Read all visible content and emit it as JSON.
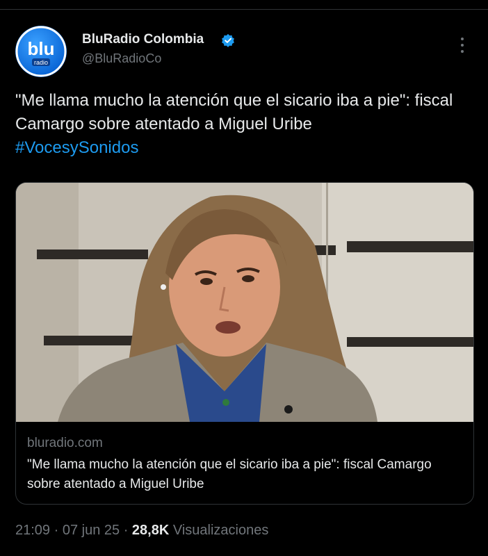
{
  "author": {
    "display_name": "BluRadio Colombia",
    "handle": "@BluRadioCo",
    "avatar_logo_text": "blu",
    "avatar_logo_subtext": "radio"
  },
  "tweet": {
    "text": "\"Me llama mucho la atención que el sicario iba a pie\": fiscal Camargo sobre atentado a Miguel Uribe",
    "hashtag": "#VocesySonidos"
  },
  "link_card": {
    "domain": "bluradio.com",
    "title": "\"Me llama mucho la atención que el sicario iba a pie\": fiscal Camargo sobre atentado a Miguel Uribe"
  },
  "meta": {
    "time": "21:09",
    "separator": " · ",
    "date": "07 jun 25",
    "views_count": "28,8K",
    "views_label": " Visualizaciones"
  },
  "colors": {
    "background": "#000000",
    "text": "#e7e9ea",
    "secondary_text": "#71767b",
    "link": "#1d9bf0",
    "border": "#2f3336"
  },
  "icons": {
    "verified": "verified-badge-icon",
    "more": "more-dots-icon"
  }
}
